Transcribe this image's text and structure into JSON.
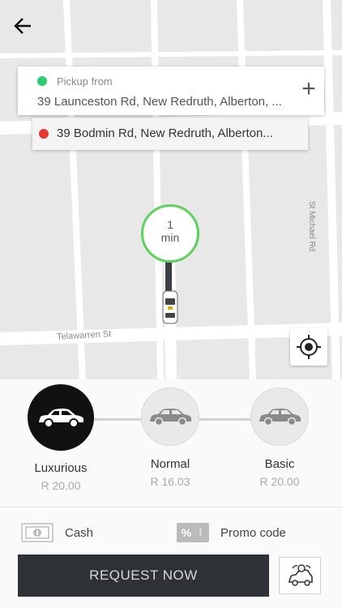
{
  "nav": {
    "back_icon": "arrow-left-icon"
  },
  "pickup": {
    "label": "Pickup from",
    "address": "39 Launceston Rd, New Redruth, Alberton, ...",
    "add_stop_label": "+",
    "dot_color": "#2ecc71"
  },
  "dropoff": {
    "address": "39 Bodmin Rd, New Redruth, Alberton...",
    "dot_color": "#e53935"
  },
  "map": {
    "street_1": "Telawarren St",
    "street_2": "St Michael Rd",
    "eta_value": "1",
    "eta_unit": "min",
    "eta_ring_color": "#5cd25c",
    "locate_icon": "crosshair-icon"
  },
  "classes": [
    {
      "name": "Luxurious",
      "price": "R 20.00",
      "selected": true
    },
    {
      "name": "Normal",
      "price": "R 16.03",
      "selected": false
    },
    {
      "name": "Basic",
      "price": "R 20.00",
      "selected": false
    }
  ],
  "payment": {
    "cash_label": "Cash",
    "promo_label": "Promo code",
    "promo_icon_text": "%"
  },
  "actions": {
    "request_label": "REQUEST NOW",
    "request_color": "#2e3136",
    "ride_icon": "ride-share-icon"
  }
}
